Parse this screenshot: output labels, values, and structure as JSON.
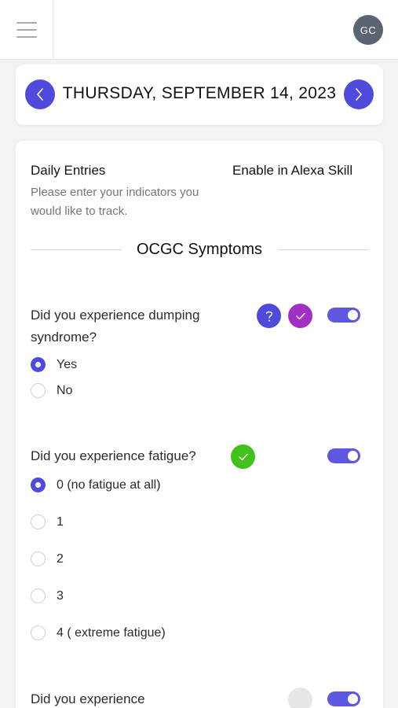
{
  "header": {
    "avatar_initials": "GC"
  },
  "date_nav": {
    "date_label": "THURSDAY, SEPTEMBER 14, 2023"
  },
  "entries": {
    "title": "Daily Entries",
    "alexa_link": "Enable in Alexa Skill",
    "subtitle": "Please enter your indicators you would like to track."
  },
  "section": {
    "title": "OCGC Symptoms"
  },
  "questions": [
    {
      "text": "Did you experience dumping syndrome?",
      "options": [
        "Yes",
        "No"
      ],
      "selected": "Yes",
      "enabled": true
    },
    {
      "text": "Did you experience fatigue?",
      "options": [
        "0 (no fatigue at all)",
        "1",
        "2",
        "3",
        "4 ( extreme fatigue)"
      ],
      "selected": "0 (no fatigue at all)",
      "enabled": true
    },
    {
      "text": "Did you experience",
      "enabled": true
    }
  ],
  "colors": {
    "accent": "#4f49dc",
    "toggle": "#5e58e0",
    "completed_purple": "#a32fc4",
    "completed_green": "#41c21b",
    "pending_grey": "#e6e6e8"
  },
  "icons": {
    "menu": "hamburger-icon",
    "prev": "chevron-left-icon",
    "next": "chevron-right-icon",
    "help": "question-mark-icon",
    "done": "check-icon"
  }
}
